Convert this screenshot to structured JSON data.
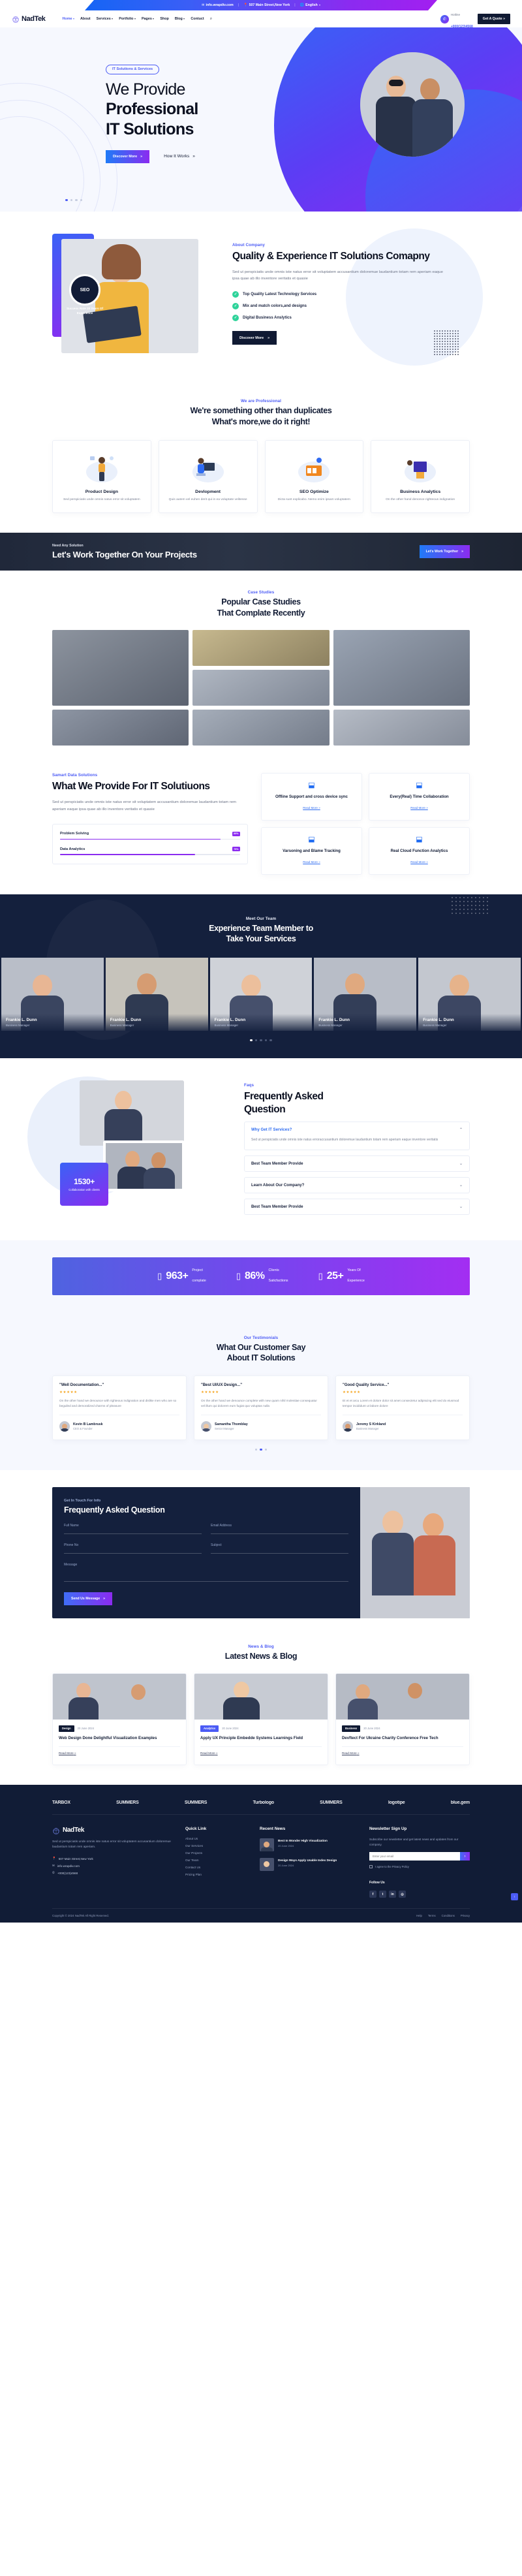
{
  "topbar": {
    "email": "info.wrapdiv.com",
    "address": "507 Main Street,New York",
    "language": "English",
    "sep": "|"
  },
  "brand": {
    "name": "NadTek"
  },
  "nav": {
    "items": [
      {
        "label": "Home",
        "caret": true,
        "active": true
      },
      {
        "label": "About",
        "caret": false,
        "active": false
      },
      {
        "label": "Services",
        "caret": true,
        "active": false
      },
      {
        "label": "Portfolio",
        "caret": true,
        "active": false
      },
      {
        "label": "Pages",
        "caret": true,
        "active": false
      },
      {
        "label": "Shop",
        "caret": false,
        "active": false
      },
      {
        "label": "Blog",
        "caret": true,
        "active": false
      },
      {
        "label": "Contuct",
        "caret": false,
        "active": false
      }
    ],
    "hotline_label": "Hotline",
    "hotline_number": "+000(123)4568",
    "quote_button": "Get A Quote",
    "search_icon": "search-icon"
  },
  "hero": {
    "pill": "IT Solutions & Services",
    "title_thin": "We Provide",
    "title_bold_1": "Professional",
    "title_bold_2": "IT Solutions",
    "primary_button": "Discover More",
    "secondary_link": "How It Works",
    "slides": 4,
    "active_slide": 0
  },
  "about": {
    "eyebrow": "About Company",
    "heading": "Quality & Experience IT Solutions Comapny",
    "paragraph": "Sed ut perspiciatis unde omnis iste natus error sit voluptatem accusantium doloremue laudantium totam rem aperiam eaque ipsa quae ab illo inventore veritatis et quasie",
    "ticks": [
      "Top Quality Latest Technology Services",
      "Mix and match colors,and designs",
      "Digital Business Anslytics"
    ],
    "button": "Discover More",
    "badge_value": "SEO",
    "badge_text": "Success Rate 20 Years Of Experience"
  },
  "services": {
    "eyebrow": "We are Professional",
    "heading_line1": "We're something other than duplicates",
    "heading_line2": "What's more,we do it right!",
    "cards": [
      {
        "title": "Product Design",
        "text": "Sed perspiciatis unde omnis natus error sit voluptatem",
        "icon": "design-illustration"
      },
      {
        "title": "Devlopment",
        "text": "Quis autem vel euhen derit qui in ea voluptate velitesse",
        "icon": "development-illustration"
      },
      {
        "title": "SEO Optimize",
        "text": "Dicta sunt explicabo. Nemo enim ipsam voluptatem",
        "icon": "seo-illustration"
      },
      {
        "title": "Business Analytics",
        "text": "On the other hand denonce righteous indignation",
        "icon": "analytics-illustration"
      }
    ]
  },
  "cta": {
    "eyebrow": "Need Any Solution",
    "heading": "Let's Work Together On Your Projects",
    "button": "Let's Work Together"
  },
  "cases": {
    "eyebrow": "Case Studies",
    "heading_line1": "Popular Case Studies",
    "heading_line2": "That Complate Recently",
    "tiles": 7
  },
  "provide": {
    "eyebrow": "Samart Data Solutions",
    "heading": "What We Provide For IT Solutiuons",
    "paragraph": "Sed ut perspiciatis unde omnis iste natus error sit voluptatem accusantium doloremue laudantium totam rem aperiam eaque ipsa quae ab illo inventore veritatis et quasie",
    "bars": [
      {
        "label": "Problem Solving",
        "pct": "89%",
        "value": 89
      },
      {
        "label": "Data Analytics",
        "pct": "75%",
        "value": 75
      }
    ],
    "features": [
      {
        "title": "Offline Support and cross device sync",
        "link": "Read More",
        "icon": "sync-icon"
      },
      {
        "title": "Every(Real) Time Collaboration",
        "link": "Read More",
        "icon": "collab-icon"
      },
      {
        "title": "Varsoning and Blame Tracking",
        "link": "Read More",
        "icon": "tracking-icon"
      },
      {
        "title": "Real Cloud Function Analytics",
        "link": "Read More",
        "icon": "cloud-icon"
      }
    ]
  },
  "team": {
    "eyebrow": "Meet Our Team",
    "heading_line1": "Experience Team Member to",
    "heading_line2": "Take Your Services",
    "members": [
      {
        "name": "Frankie L. Dunn",
        "role": "Business Manager"
      },
      {
        "name": "Frankie L. Dunn",
        "role": "Business Manager"
      },
      {
        "name": "Frankie L. Dunn",
        "role": "Business Manager"
      },
      {
        "name": "Frankie L. Dunn",
        "role": "Business Manager"
      },
      {
        "name": "Frankie L. Dunn",
        "role": "Business Manager"
      }
    ],
    "slides": 5,
    "active_slide": 0
  },
  "faq": {
    "eyebrow": "Faqs",
    "heading_line1": "Frequently Asked",
    "heading_line2": "Question",
    "counter_value": "1530+",
    "counter_label": "Collaboration with clients",
    "items": [
      {
        "q": "Why Get IT Services?",
        "a": "Sed ut perspiciatis unde omnis iste natus erroraccusantium doloremue laudantium totam rem aperiam eaque inventore veritatis",
        "open": true
      },
      {
        "q": "Best Team Member Provide",
        "a": "",
        "open": false
      },
      {
        "q": "Learn About Our Company?",
        "a": "",
        "open": false
      },
      {
        "q": "Best Team Member Provide",
        "a": "",
        "open": false
      }
    ]
  },
  "stats": [
    {
      "value": "963+",
      "label_line1": "Project",
      "label_line2": "complate",
      "icon": "briefcase-icon"
    },
    {
      "value": "86%",
      "label_line1": "Clients",
      "label_line2": "Saticfactions",
      "icon": "smile-icon"
    },
    {
      "value": "25+",
      "label_line1": "Years Of",
      "label_line2": "Experience",
      "icon": "award-icon"
    }
  ],
  "testimonials": {
    "eyebrow": "Our Testimonials",
    "heading_line1": "What Our Customer Say",
    "heading_line2": "About IT Solutions",
    "cards": [
      {
        "title": "\"Well Documentation...\"",
        "stars": "★★★★★",
        "text": "On the other hand we denounce with righteous indignation and dislike men who are so beguiled and demoralized charms of pleasure",
        "author": "Kevin B Lambrusk",
        "role": "CEO & Founder"
      },
      {
        "title": "\"Best UI/UX Design...\"",
        "stars": "★★★★★",
        "text": "On the other hand we denounce complete with new quam nihil molestiae consequatur vel illum qui dolorem eum fugiat quo voluptas nulla",
        "author": "Samantha Thomblay",
        "role": "Senior Manager"
      },
      {
        "title": "\"Good Quality Service...\"",
        "stars": "★★★★★",
        "text": "Et et et arcu Lorem et dolore dolor sit amet consectetur adipiscing elit sed do eiusmod tempor incididunt ut labore dolore",
        "author": "Jeremy S Kirkland",
        "role": "Business Manager"
      }
    ],
    "slides": 3,
    "active_slide": 1
  },
  "contact": {
    "eyebrow": "Get In Touch For Info",
    "heading": "Frequently Asked Question",
    "fields": [
      {
        "label": "Full Name"
      },
      {
        "label": "Email Address"
      },
      {
        "label": "Phone No"
      },
      {
        "label": "Subject"
      },
      {
        "label": "Message"
      }
    ],
    "button": "Send Us Message"
  },
  "blog": {
    "eyebrow": "News & Blog",
    "heading": "Latest News & Blog",
    "posts": [
      {
        "tag": "Design",
        "tag2": "",
        "date": "20 June 2024",
        "title": "Web Design Done Delightful Visualization Examples",
        "link": "Read More"
      },
      {
        "tag": "Analytics",
        "tag2": "",
        "date": "20 June 2024",
        "title": "Apply UX Principle Embedde Systems Learnings Field",
        "link": "Read More"
      },
      {
        "tag": "Business",
        "tag2": "",
        "date": "20 June 2024",
        "title": "Devftect For Ukraine Charity Conference Free Tech",
        "link": "Read More"
      }
    ]
  },
  "partners": [
    "TARBOX",
    "SUMMERS",
    "SUMMERS",
    "Turbologo",
    "SUMMERS",
    "logotipe",
    "blue.gem"
  ],
  "footer": {
    "brand": "NadTek",
    "about": "Sed ut perspiciatis unde omnis iste natus error sit voluptatem accusantium doloremue laudantium totam rem aperiam.",
    "contacts": [
      "507 Main Street,New York",
      "info.wrapdiv.com",
      "+000(123)4568"
    ],
    "quick_link_title": "Quick Link",
    "quick_links": [
      "About Us",
      "Our Services",
      "Our Projects",
      "Our Team",
      "Contact Us",
      "Pricing Plan"
    ],
    "recent_title": "Recent News",
    "recent": [
      {
        "title": "Best In Wonder High Visualization",
        "date": "20 June 2024"
      },
      {
        "title": "Design Ways Apply Usable Index Design",
        "date": "20 June 2024"
      }
    ],
    "newsletter_title": "Newsletter Sign Up",
    "newsletter_text": "Subscribe our newsletter and get latest news and updates from our company.",
    "newsletter_placeholder": "Enter your email",
    "consent": "I agree to the Privacy Policy",
    "follow_label": "Follow Us",
    "socials": [
      "facebook-icon",
      "twitter-icon",
      "linkedin-icon",
      "instagram-icon"
    ],
    "copyright": "Copyright © 2024 NadTek All Right Reserved.",
    "bottom_links": [
      "Help",
      "Terms",
      "Conditions",
      "Privacy"
    ],
    "scrolltop_icon": "arrow-up-icon"
  },
  "colors": {
    "accent": "#4b5bf5",
    "accent2": "#8b2bf0",
    "dark": "#14203d",
    "green": "#2fd39a"
  }
}
